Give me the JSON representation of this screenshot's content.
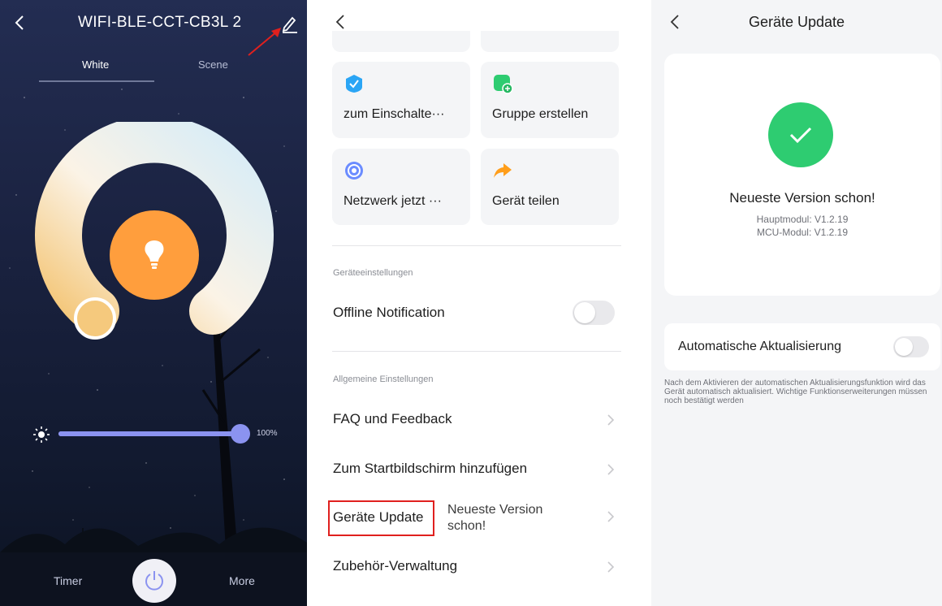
{
  "lamp": {
    "title": "WIFI-BLE-CCT-CB3L 2",
    "tabs": [
      {
        "label": "White",
        "active": true
      },
      {
        "label": "Scene",
        "active": false
      }
    ],
    "brightness": {
      "value": 100,
      "label": "100%"
    },
    "bottom": {
      "timer_label": "Timer",
      "more_label": "More"
    },
    "colors": {
      "bulb": "#ff9e3d",
      "accent": "#8b93f0"
    }
  },
  "settings": {
    "quick_actions": [
      {
        "label": "zum Einschalte···",
        "icon": "shield-check-icon",
        "color": "#2aa5f5"
      },
      {
        "label": "Gruppe erstellen",
        "icon": "add-group-icon",
        "color": "#2ecc71"
      },
      {
        "label": "Netzwerk jetzt ···",
        "icon": "network-icon",
        "color": "#6b8cff"
      },
      {
        "label": "Gerät teilen",
        "icon": "share-icon",
        "color": "#ff9e1b"
      }
    ],
    "device_section_label": "Geräteeinstellungen",
    "offline_notification": {
      "label": "Offline Notification",
      "enabled": false
    },
    "general_section_label": "Allgemeine Einstellungen",
    "rows": [
      {
        "label": "FAQ und Feedback"
      },
      {
        "label": "Zum Startbildschirm hinzufügen"
      },
      {
        "label": "Geräte Update",
        "status": "Neueste Version schon!"
      },
      {
        "label": "Zubehör-Verwaltung"
      }
    ]
  },
  "update": {
    "title": "Geräte Update",
    "headline": "Neueste Version schon!",
    "main_module": "Hauptmodul: V1.2.19",
    "mcu_module": "MCU-Modul: V1.2.19",
    "auto_update": {
      "label": "Automatische Aktualisierung",
      "enabled": false
    },
    "note": "Nach dem Aktivieren der automatischen Aktualisierungsfunktion wird das Gerät automatisch aktualisiert. Wichtige Funktionserweiterungen müssen noch bestätigt werden",
    "colors": {
      "success": "#2ecc71"
    }
  }
}
